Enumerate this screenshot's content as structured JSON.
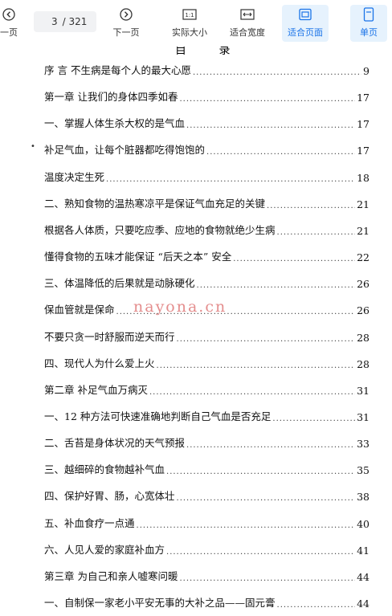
{
  "toolbar": {
    "prev_label": "一页",
    "page_current": "3",
    "page_total": "/ 321",
    "next_label": "下一页",
    "actual_size_label": "实际大小",
    "fit_width_label": "适合宽度",
    "fit_page_label": "适合页面",
    "single_page_label": "单页",
    "active_color": "#1a73e8"
  },
  "doc": {
    "header_fragment": "目 录",
    "watermark": "nayona.cn",
    "toc": [
      {
        "title": "序  言    不生病是每个人的最大心愿",
        "page": "9"
      },
      {
        "title": "第一章    让我们的身体四季如春",
        "page": "17"
      },
      {
        "title": "一、掌握人体生杀大权的是气血",
        "page": "17"
      },
      {
        "title": "补足气血，让每个脏器都吃得饱饱的",
        "page": "17"
      },
      {
        "title": "温度决定生死",
        "page": "18"
      },
      {
        "title": "二、熟知食物的温热寒凉平是保证气血充足的关键",
        "page": "21"
      },
      {
        "title": "根据各人体质，只要吃应季、应地的食物就绝少生病",
        "page": "21"
      },
      {
        "title": "懂得食物的五味才能保证 “后天之本” 安全",
        "page": "22"
      },
      {
        "title": "三、体温降低的后果就是动脉硬化",
        "page": "26"
      },
      {
        "title": "保血管就是保命",
        "page": "26"
      },
      {
        "title": "不要只贪一时舒服而逆天而行",
        "page": "28"
      },
      {
        "title": "四、现代人为什么爱上火",
        "page": "28"
      },
      {
        "title": "第二章    补足气血万病灭",
        "page": "31"
      },
      {
        "title": "一、12 种方法可快速准确地判断自己气血是否充足",
        "page": "31"
      },
      {
        "title": "二、舌苔是身体状况的天气预报",
        "page": "33"
      },
      {
        "title": "三、越细碎的食物越补气血",
        "page": "35"
      },
      {
        "title": "四、保护好胃、肠，心宽体壮",
        "page": "38"
      },
      {
        "title": "五、补血食疗一点通",
        "page": "40"
      },
      {
        "title": "六、人见人爱的家庭补血方",
        "page": "41"
      },
      {
        "title": "第三章    为自己和亲人嘘寒问暖",
        "page": "44"
      },
      {
        "title": "一、自制保一家老小平安无事的大补之品——固元膏",
        "page": "44"
      }
    ]
  }
}
